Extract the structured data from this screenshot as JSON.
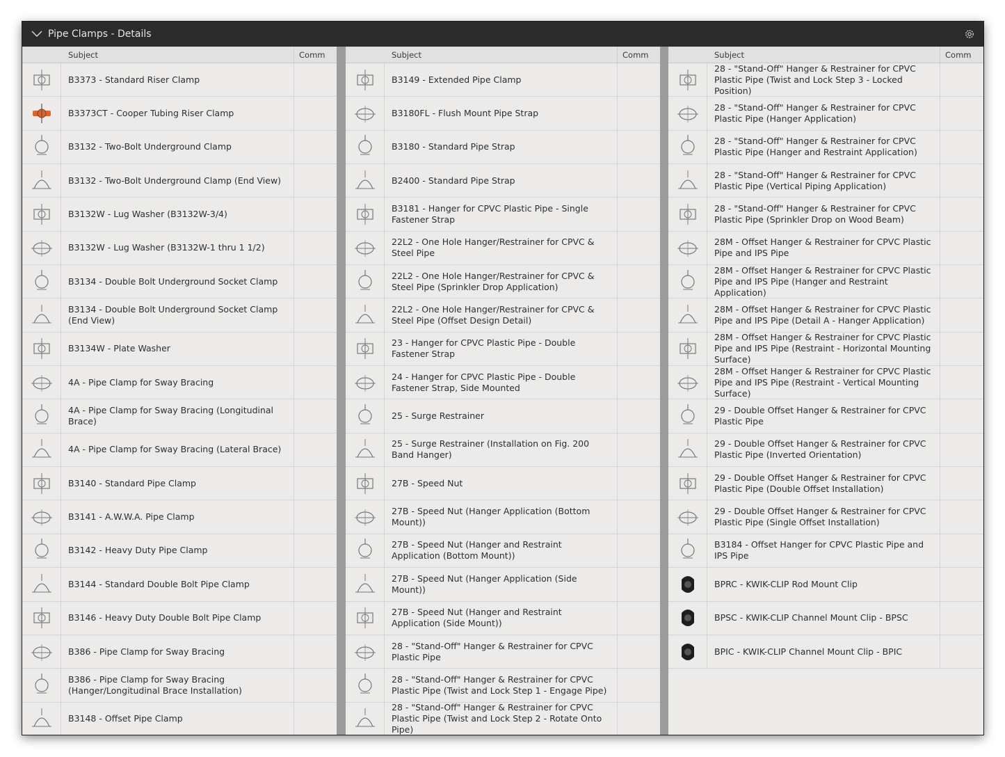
{
  "window": {
    "title": "Pipe Clamps - Details"
  },
  "header": {
    "subject": "Subject",
    "comm": "Comm"
  },
  "columns": [
    {
      "rows": [
        {
          "icon": "riser-clamp-drawing-icon",
          "subject": "B3373 - Standard Riser Clamp"
        },
        {
          "icon": "copper-riser-clamp-icon",
          "subject": "B3373CT - Cooper Tubing Riser Clamp",
          "accent": "#e0622a"
        },
        {
          "icon": "two-bolt-clamp-drawing-icon",
          "subject": "B3132 - Two-Bolt Underground Clamp"
        },
        {
          "icon": "clamp-end-view-drawing-icon",
          "subject": "B3132 - Two-Bolt Underground Clamp (End View)"
        },
        {
          "icon": "lug-washer-drawing-icon",
          "subject": "B3132W - Lug Washer (B3132W-3/4)"
        },
        {
          "icon": "lug-washer-drawing-icon",
          "subject": "B3132W - Lug Washer (B3132W-1 thru 1 1/2)"
        },
        {
          "icon": "socket-clamp-drawing-icon",
          "subject": "B3134 - Double Bolt Underground Socket Clamp"
        },
        {
          "icon": "clamp-end-view-drawing-icon",
          "subject": "B3134 - Double Bolt Underground Socket Clamp (End View)"
        },
        {
          "icon": "plate-washer-drawing-icon",
          "subject": "B3134W - Plate Washer"
        },
        {
          "icon": "sway-brace-clamp-drawing-icon",
          "subject": "4A - Pipe Clamp for Sway Bracing"
        },
        {
          "icon": "brace-installation-drawing-icon",
          "subject": "4A - Pipe Clamp for Sway Bracing (Longitudinal Brace)"
        },
        {
          "icon": "brace-installation-drawing-icon",
          "subject": "4A - Pipe Clamp for Sway Bracing (Lateral Brace)"
        },
        {
          "icon": "pipe-clamp-drawing-icon",
          "subject": "B3140 - Standard Pipe Clamp"
        },
        {
          "icon": "pipe-clamp-drawing-icon",
          "subject": "B3141 - A.W.W.A. Pipe Clamp"
        },
        {
          "icon": "pipe-clamp-drawing-icon",
          "subject": "B3142 - Heavy Duty Pipe Clamp"
        },
        {
          "icon": "pipe-clamp-drawing-icon",
          "subject": "B3144 - Standard Double Bolt Pipe Clamp"
        },
        {
          "icon": "pipe-clamp-drawing-icon",
          "subject": "B3146 - Heavy Duty Double Bolt Pipe Clamp"
        },
        {
          "icon": "sway-brace-clamp-drawing-icon",
          "subject": "B386 - Pipe Clamp for Sway Bracing"
        },
        {
          "icon": "brace-installation-drawing-icon",
          "subject": "B386 - Pipe Clamp for Sway Bracing (Hanger/Longitudinal Brace Installation)"
        },
        {
          "icon": "offset-clamp-drawing-icon",
          "subject": "B3148 - Offset Pipe Clamp"
        }
      ]
    },
    {
      "rows": [
        {
          "icon": "extended-clamp-drawing-icon",
          "subject": "B3149 - Extended Pipe Clamp"
        },
        {
          "icon": "pipe-strap-drawing-icon",
          "subject": "B3180FL - Flush Mount Pipe Strap"
        },
        {
          "icon": "pipe-strap-drawing-icon",
          "subject": "B3180 - Standard Pipe Strap"
        },
        {
          "icon": "strap-installation-drawing-icon",
          "subject": "B2400 - Standard Pipe Strap"
        },
        {
          "icon": "single-fastener-strap-drawing-icon",
          "subject": "B3181 - Hanger for CPVC Plastic Pipe - Single Fastener Strap"
        },
        {
          "icon": "one-hole-hanger-drawing-icon",
          "subject": "22L2 - One Hole Hanger/Restrainer for CPVC & Steel Pipe"
        },
        {
          "icon": "sprinkler-drop-drawing-icon",
          "subject": "22L2 - One Hole Hanger/Restrainer for CPVC & Steel Pipe (Sprinkler Drop Application)"
        },
        {
          "icon": "offset-design-drawing-icon",
          "subject": "22L2 - One Hole Hanger/Restrainer for CPVC & Steel Pipe (Offset Design Detail)"
        },
        {
          "icon": "double-fastener-strap-drawing-icon",
          "subject": "23 - Hanger for CPVC Plastic Pipe - Double Fastener Strap"
        },
        {
          "icon": "side-mounted-strap-drawing-icon",
          "subject": "24 - Hanger for CPVC Plastic Pipe - Double Fastener Strap, Side Mounted"
        },
        {
          "icon": "surge-restrainer-drawing-icon",
          "subject": "25 - Surge Restrainer"
        },
        {
          "icon": "band-hanger-drawing-icon",
          "subject": "25 - Surge Restrainer (Installation on Fig. 200 Band Hanger)"
        },
        {
          "icon": "speed-nut-drawing-icon",
          "subject": "27B - Speed Nut"
        },
        {
          "icon": "rod-application-drawing-icon",
          "subject": "27B - Speed Nut (Hanger Application (Bottom Mount))"
        },
        {
          "icon": "rod-application-drawing-icon",
          "subject": "27B - Speed Nut (Hanger and Restraint Application (Bottom Mount))"
        },
        {
          "icon": "rod-application-drawing-icon",
          "subject": "27B - Speed Nut (Hanger Application (Side Mount))"
        },
        {
          "icon": "rod-application-drawing-icon",
          "subject": "27B - Speed Nut (Hanger and Restraint Application (Side Mount))"
        },
        {
          "icon": "stand-off-hanger-drawing-icon",
          "subject": "28 - \"Stand-Off\" Hanger & Restrainer for CPVC Plastic Pipe"
        },
        {
          "icon": "stand-off-hanger-drawing-icon",
          "subject": "28 - \"Stand-Off\" Hanger & Restrainer for CPVC Plastic Pipe (Twist and Lock Step 1 - Engage Pipe)"
        },
        {
          "icon": "stand-off-hanger-drawing-icon",
          "subject": "28 - \"Stand-Off\" Hanger & Restrainer for CPVC Plastic Pipe (Twist and Lock Step 2 - Rotate Onto Pipe)"
        }
      ]
    },
    {
      "rows": [
        {
          "icon": "stand-off-hanger-drawing-icon",
          "subject": "28 - \"Stand-Off\" Hanger & Restrainer for CPVC Plastic Pipe (Twist and Lock Step 3 - Locked Position)"
        },
        {
          "icon": "hanger-application-drawing-icon",
          "subject": "28 - \"Stand-Off\" Hanger & Restrainer for CPVC Plastic Pipe (Hanger Application)"
        },
        {
          "icon": "hanger-application-drawing-icon",
          "subject": "28 - \"Stand-Off\" Hanger & Restrainer for CPVC Plastic Pipe (Hanger and Restraint Application)"
        },
        {
          "icon": "vertical-piping-drawing-icon",
          "subject": "28 - \"Stand-Off\" Hanger & Restrainer for CPVC Plastic Pipe (Vertical Piping Application)"
        },
        {
          "icon": "wood-beam-drawing-icon",
          "subject": "28 - \"Stand-Off\" Hanger & Restrainer for CPVC Plastic Pipe (Sprinkler Drop on Wood Beam)"
        },
        {
          "icon": "offset-hanger-drawing-icon",
          "subject": "28M - Offset Hanger & Restrainer for CPVC Plastic Pipe and IPS Pipe"
        },
        {
          "icon": "rod-application-drawing-icon",
          "subject": "28M - Offset Hanger & Restrainer for CPVC Plastic Pipe and IPS Pipe (Hanger and Restraint Application)"
        },
        {
          "icon": "detail-drawing-icon",
          "subject": "28M - Offset Hanger & Restrainer for CPVC Plastic Pipe and IPS Pipe (Detail A - Hanger Application)"
        },
        {
          "icon": "horizontal-mount-drawing-icon",
          "subject": "28M - Offset Hanger & Restrainer for CPVC Plastic Pipe and IPS Pipe (Restraint - Horizontal Mounting Surface)"
        },
        {
          "icon": "vertical-mount-drawing-icon",
          "subject": "28M - Offset Hanger & Restrainer for CPVC Plastic Pipe and IPS Pipe (Restraint - Vertical Mounting Surface)"
        },
        {
          "icon": "double-offset-hanger-drawing-icon",
          "subject": "29 - Double Offset Hanger & Restrainer for CPVC Plastic Pipe"
        },
        {
          "icon": "double-offset-hanger-drawing-icon",
          "subject": "29 - Double Offset Hanger & Restrainer for CPVC Plastic Pipe (Inverted Orientation)"
        },
        {
          "icon": "double-offset-hanger-drawing-icon",
          "subject": "29 - Double Offset Hanger & Restrainer for CPVC Plastic Pipe (Double Offset Installation)"
        },
        {
          "icon": "double-offset-hanger-drawing-icon",
          "subject": "29 - Double Offset Hanger & Restrainer for CPVC Plastic Pipe (Single Offset Installation)"
        },
        {
          "icon": "offset-hanger-drawing-icon",
          "subject": "B3184 - Offset Hanger for CPVC Plastic Pipe and IPS Pipe"
        },
        {
          "icon": "kwik-clip-rod-mount-icon",
          "subject": "BPRC - KWIK-CLIP Rod Mount Clip",
          "solid": true
        },
        {
          "icon": "kwik-clip-channel-mount-icon",
          "subject": "BPSC - KWIK-CLIP Channel Mount Clip - BPSC",
          "solid": true
        },
        {
          "icon": "kwik-clip-channel-mount-icon",
          "subject": "BPIC - KWIK-CLIP Channel Mount Clip - BPIC",
          "solid": true
        }
      ]
    }
  ]
}
